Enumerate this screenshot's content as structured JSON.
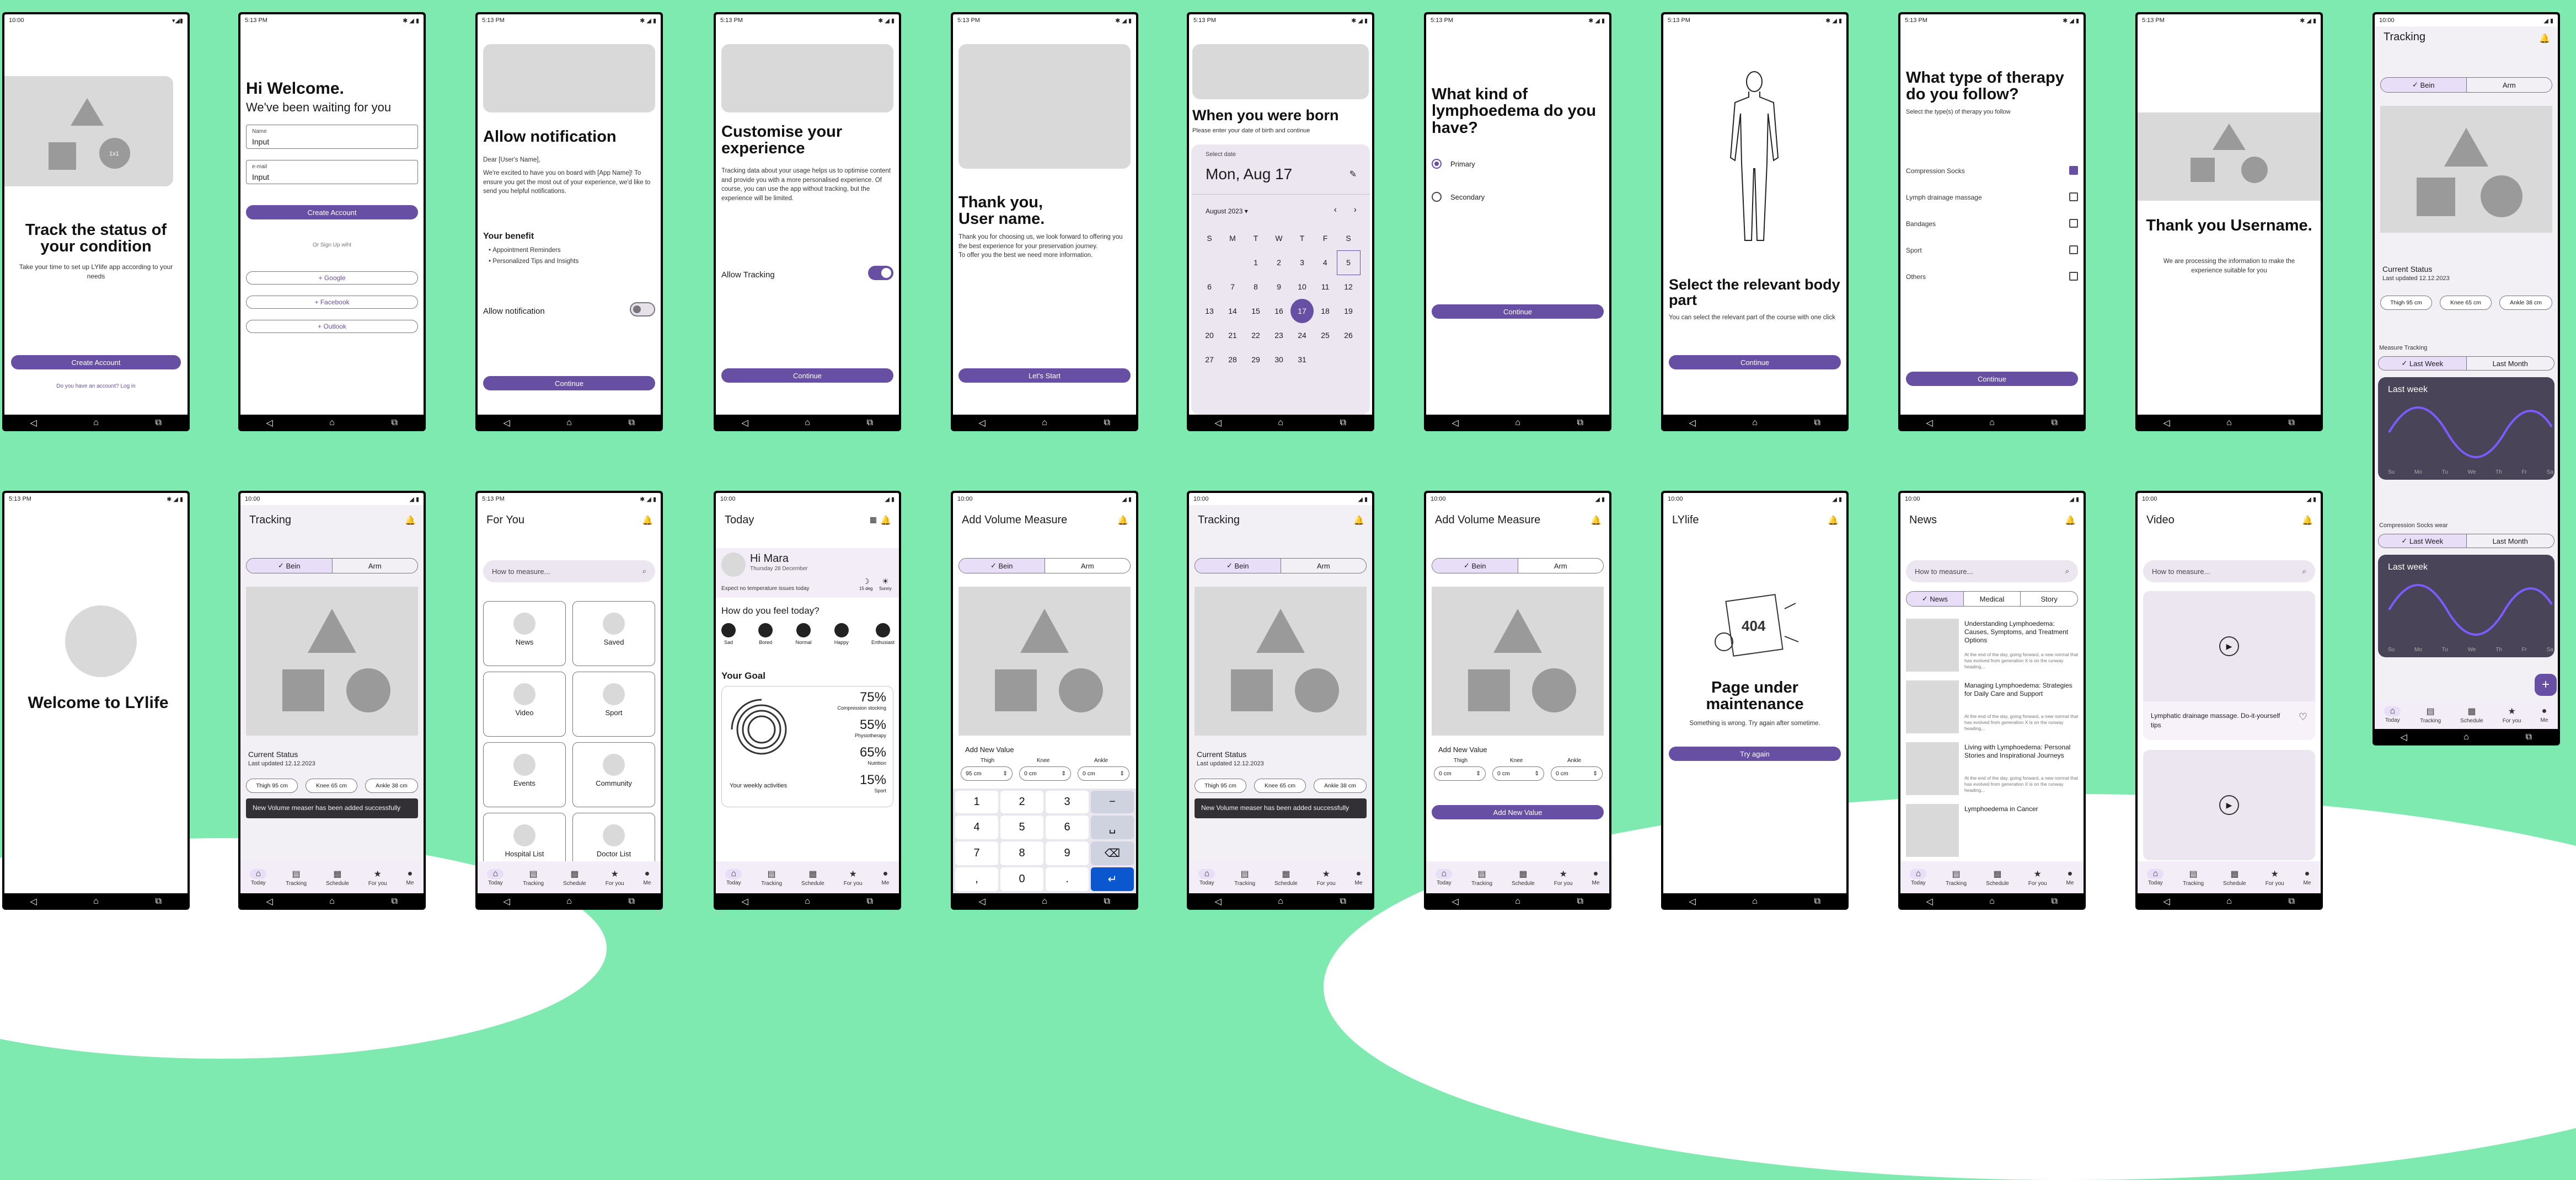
{
  "status": {
    "time1": "10:00",
    "time2": "5:13 PM"
  },
  "s1": {
    "title": "Track the status of your condition",
    "body": "Take your time to set up LYlife app according to your needs",
    "btn": "Create Account",
    "link": "Do you have an account? Log in",
    "badge": "1x1"
  },
  "s2": {
    "title": "Hi Welcome.",
    "subtitle": "We've been waiting for you",
    "name_label": "Name",
    "name_val": "Input",
    "email_label": "e-mail",
    "email_val": "Input",
    "btn": "Create Account",
    "or": "Or Sign Up wiht",
    "google": "Google",
    "facebook": "Facebook",
    "outlook": "Outlook"
  },
  "s3": {
    "title": "Allow notification",
    "p1": "Dear [User's Name],",
    "p2": "We're excited to have you on board with [App Name]! To ensure you get the most out of your experience, we'd like to send you helpful notifications.",
    "benefit_title": "Your benefit",
    "b1": "Appointment Reminders",
    "b2": "Personalized Tips and Insights",
    "toggle_label": "Allow notification",
    "btn": "Continue"
  },
  "s4": {
    "title": "Customise your experience",
    "body": "Tracking data about your usage helps us to optimise content and provide you with a more personalised experience. Of course, you can use the app without tracking, but the experience will be limited.",
    "toggle_label": "Allow Tracking",
    "btn": "Continue"
  },
  "s5": {
    "title": "Thank you, User name.",
    "body": "Thank you for choosing us, we look forward to offering you the best experience for your preservation journey.\nTo offer you the best we need more information.",
    "btn": "Let's Start"
  },
  "s6": {
    "title": "When you were born",
    "sub": "Please enter your date of birth and continue",
    "select": "Select date",
    "date": "Mon, Aug 17",
    "month": "August 2023",
    "days": [
      "S",
      "M",
      "T",
      "W",
      "T",
      "F",
      "S"
    ],
    "rows": [
      [
        "",
        "",
        "1",
        "2",
        "3",
        "4",
        "5"
      ],
      [
        "6",
        "7",
        "8",
        "9",
        "10",
        "11",
        "12"
      ],
      [
        "13",
        "14",
        "15",
        "16",
        "17",
        "18",
        "19"
      ],
      [
        "20",
        "21",
        "22",
        "23",
        "24",
        "25",
        "26"
      ],
      [
        "27",
        "28",
        "29",
        "30",
        "31",
        "",
        ""
      ]
    ]
  },
  "s7": {
    "title": "What kind of lymphoedema do you have?",
    "opt1": "Primary",
    "opt2": "Secondary",
    "btn": "Continue"
  },
  "s8": {
    "title": "Select the relevant body part",
    "body": "You can select the relevant part of the course with one click",
    "btn": "Continue"
  },
  "s9": {
    "title": "What type of therapy do you follow?",
    "sub": "Select the type(s) of therapy you follow",
    "items": [
      "Compression Socks",
      "Lymph drainage massage",
      "Bandages",
      "Sport",
      "Others"
    ],
    "btn": "Continue"
  },
  "s10": {
    "title": "Thank you Username.",
    "body": "We are processing the information to make the experience suitable for you"
  },
  "s11": {
    "title": "Tracking",
    "seg1": "Bein",
    "seg2": "Arm",
    "status": "Current Status",
    "updated": "Last updated 12.12.2023",
    "chips": [
      "Thigh 95 cm",
      "Knee 65 cm",
      "Ankle 38 cm"
    ],
    "measure": "Measure Tracking",
    "lw": "Last Week",
    "lm": "Last Month",
    "graph": "Last week",
    "days": [
      "Su",
      "Mo",
      "Tu",
      "We",
      "Th",
      "Fr",
      "Sa"
    ],
    "socks": "Compression Socks wear",
    "fab": "+"
  },
  "s12": {
    "title": "Welcome to LYlife"
  },
  "s13": {
    "title": "Tracking",
    "seg1": "Bein",
    "seg2": "Arm",
    "status": "Current Status",
    "updated": "Last updated 12.12.2023",
    "chips": [
      "Thigh 95 cm",
      "Knee 65 cm",
      "Ankle 38 cm"
    ],
    "toast": "New Volume measer has been added successfully"
  },
  "s14": {
    "title": "For You",
    "search": "How to measure...",
    "tiles": [
      "News",
      "Saved",
      "Video",
      "Sport",
      "Events",
      "Community",
      "Hospital List",
      "Doctor List"
    ]
  },
  "s15": {
    "title": "Today",
    "name": "Hi Mara",
    "date": "Thursday 28 December",
    "hint": "Expect no temperature issues today",
    "w1": "15 deg",
    "w2": "Sunny",
    "question": "How do you feel today?",
    "moods": [
      "Sad",
      "Bored",
      "Normal",
      "Happy",
      "Enthusiast"
    ],
    "goal": "Your Goal",
    "p1": "75%",
    "l1": "Compression stocking",
    "p2": "55%",
    "l2": "Physiotherapy",
    "p3": "65%",
    "l3": "Nutrition",
    "p4": "15%",
    "l4": "Sport",
    "weekly": "Your weekly activities"
  },
  "s16": {
    "title": "Add Volume Measure",
    "seg1": "Bein",
    "seg2": "Arm",
    "add": "Add New Value",
    "cols": [
      "Thigh",
      "Knee",
      "Ankle"
    ],
    "vals": [
      "95 cm",
      "0 cm",
      "0 cm"
    ],
    "keys": [
      "1",
      "2",
      "3",
      "−",
      "4",
      "5",
      "6",
      "␣",
      "7",
      "8",
      "9",
      "⌫",
      ",",
      "0",
      ".",
      "↵"
    ]
  },
  "s17": {
    "title": "Tracking",
    "seg1": "Bein",
    "seg2": "Arm",
    "status": "Current Status",
    "updated": "Last updated 12.12.2023",
    "chips": [
      "Thigh 95 cm",
      "Knee 65 cm",
      "Ankle 38 cm"
    ],
    "toast": "New Volume measer has been added successfully"
  },
  "s18": {
    "title": "Add Volume Measure",
    "seg1": "Bein",
    "seg2": "Arm",
    "add": "Add New Value",
    "cols": [
      "Thigh",
      "Knee",
      "Ankle"
    ],
    "vals": [
      "0 cm",
      "0 cm",
      "0 cm"
    ],
    "btn": "Add New Value"
  },
  "s19": {
    "title": "LYlife",
    "heading": "Page under maintenance",
    "body": "Something is wrong. Try again after sometime.",
    "btn": "Try again",
    "art": "404"
  },
  "s20": {
    "title": "News",
    "search": "How to measure...",
    "tabs": [
      "News",
      "Medical",
      "Story"
    ],
    "items": [
      "Understanding Lymphoedema: Causes, Symptoms, and Treatment Options",
      "Managing Lymphoedema: Strategies for Daily Care and Support",
      "Living with Lymphoedema: Personal Stories and Inspirational Journeys",
      "Lymphoedema in Cancer"
    ],
    "snippet": "At the end of the day, going forward, a new normal that has evolved from generation X is on the runway heading..."
  },
  "s21": {
    "title": "Video",
    "search": "How to measure...",
    "caption": "Lymphatic drainage massage. Do-it-yourself tips"
  },
  "bnav": {
    "today": "Today",
    "tracking": "Tracking",
    "schedule": "Schedule",
    "foryou": "For you",
    "me": "Me"
  }
}
